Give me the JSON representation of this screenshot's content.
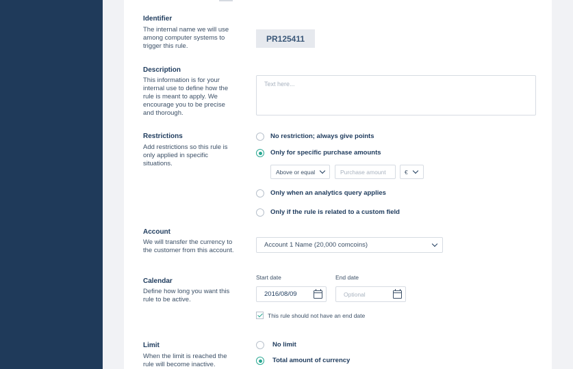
{
  "identifier": {
    "label": "Identifier",
    "description": "The internal name we will use among computer systems to trigger this rule.",
    "value": "PR125411"
  },
  "description": {
    "label": "Description",
    "description": "This information is for your internal use to define how the rule is meant to apply. We encourage you to be precise and thorough.",
    "placeholder": "Text here..."
  },
  "restrictions": {
    "label": "Restrictions",
    "description": "Add restrictions so this rule is only applied in specific situations.",
    "options": [
      "No restriction; always give points",
      "Only for specific purchase amounts",
      "Only when an analytics query applies",
      "Only if the rule is related to a custom field"
    ],
    "selected": 1,
    "comparator": "Above or equal",
    "amount_placeholder": "Purchase amount",
    "currency": "€"
  },
  "account": {
    "label": "Account",
    "description": "We will transfer the currency to the customer from this account.",
    "selected": "Account 1 Name (20,000 comcoins)"
  },
  "calendar": {
    "label": "Calendar",
    "description": "Define how long you want this rule to be active.",
    "start_label": "Start date",
    "start_value": "2016/08/09",
    "end_label": "End date",
    "end_placeholder": "Optional",
    "no_end_label": "This rule should not have an end date",
    "no_end_checked": true
  },
  "limit": {
    "label": "Limit",
    "description": "When the limit is reached the rule will become inactive.",
    "options": [
      "No limit",
      "Total amount of currency"
    ],
    "selected": 1
  },
  "colors": {
    "sidebar": "#1f3a5a",
    "accent": "#2aa892",
    "text": "#1d3a5c"
  }
}
